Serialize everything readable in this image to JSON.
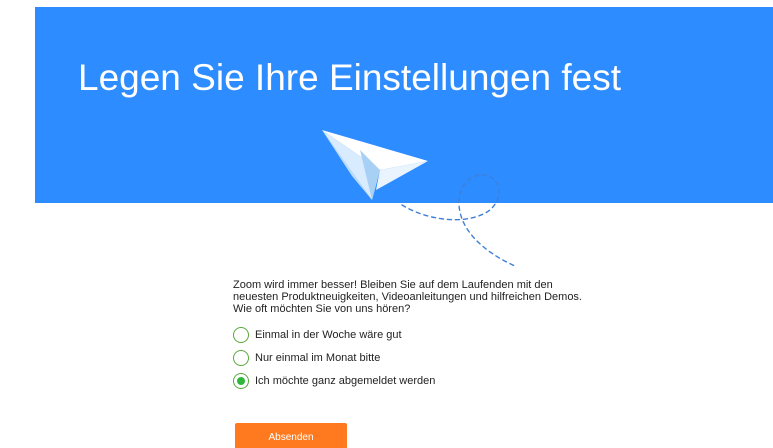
{
  "banner": {
    "title": "Legen Sie Ihre Einstellungen fest",
    "background_color": "#2d8cff",
    "illustration": "paper-plane-icon"
  },
  "intro": {
    "lines": [
      "Zoom wird immer besser! Bleiben Sie auf dem Laufenden mit den",
      "neuesten Produktneuigkeiten, Videoanleitungen und hilfreichen Demos.",
      "Wie oft möchten Sie von uns hören?"
    ]
  },
  "options": [
    {
      "label": "Einmal in der Woche wäre gut",
      "selected": false
    },
    {
      "label": "Nur einmal im Monat bitte",
      "selected": false
    },
    {
      "label": "Ich möchte ganz abgemeldet werden",
      "selected": true
    }
  ],
  "submit": {
    "label": "Absenden",
    "color": "#ff7a1f"
  },
  "colors": {
    "radio_selected": "#2fb63c",
    "radio_border": "#5aa83a",
    "dashed_path": "#3f7fd6"
  }
}
